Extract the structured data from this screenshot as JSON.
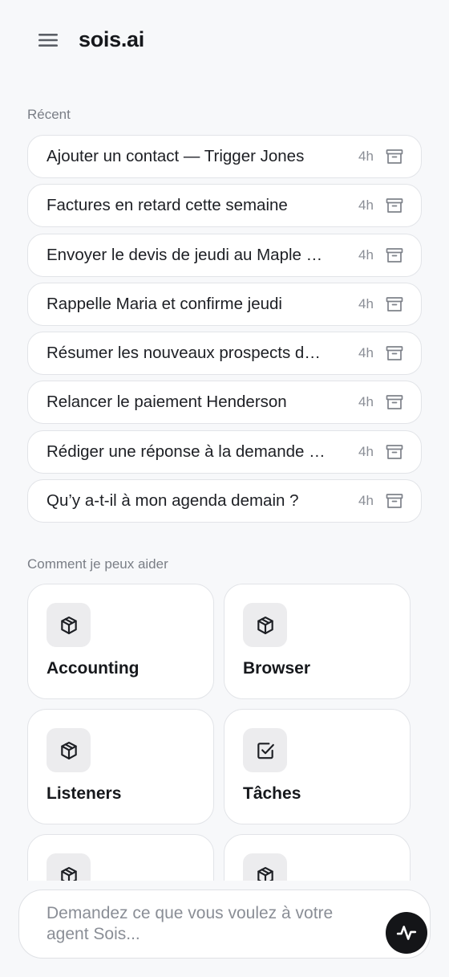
{
  "header": {
    "title": "sois.ai",
    "menu_icon": "hamburger-menu-icon"
  },
  "recent": {
    "label": "Récent",
    "items": [
      {
        "title": "Ajouter un contact — Trigger Jones",
        "time": "4h"
      },
      {
        "title": "Factures en retard cette semaine",
        "time": "4h"
      },
      {
        "title": "Envoyer le devis de jeudi au Maple …",
        "time": "4h"
      },
      {
        "title": "Rappelle Maria et confirme jeudi",
        "time": "4h"
      },
      {
        "title": "Résumer les nouveaux prospects d…",
        "time": "4h"
      },
      {
        "title": "Relancer le paiement Henderson",
        "time": "4h"
      },
      {
        "title": "Rédiger une réponse à la demande …",
        "time": "4h"
      },
      {
        "title": "Qu’y a-t-il à mon agenda demain ?",
        "time": "4h"
      }
    ],
    "archive_icon": "archive-icon"
  },
  "help": {
    "label": "Comment je peux aider",
    "cards": [
      {
        "label": "Accounting",
        "icon": "cube-icon"
      },
      {
        "label": "Browser",
        "icon": "cube-icon"
      },
      {
        "label": "Listeners",
        "icon": "cube-icon"
      },
      {
        "label": "Tâches",
        "icon": "checkbox-icon"
      },
      {
        "label": "",
        "icon": "cube-icon"
      },
      {
        "label": "",
        "icon": "cube-icon"
      }
    ]
  },
  "composer": {
    "placeholder": "Demandez ce que vous voulez à votre agent Sois...",
    "value": "",
    "send_icon": "activity-pulse-icon"
  },
  "colors": {
    "background": "#f7f8fa",
    "card": "#ffffff",
    "border": "#e2e4e8",
    "send_button": "#141518",
    "muted_text": "#7a7e86"
  }
}
